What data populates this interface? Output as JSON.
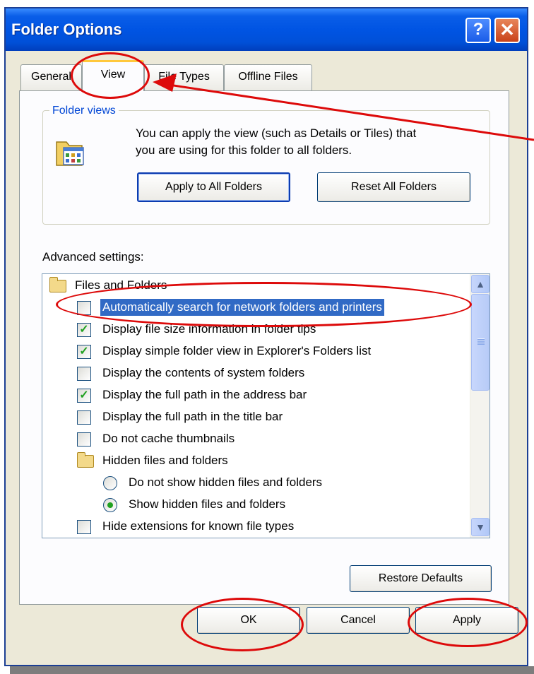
{
  "window": {
    "title": "Folder Options",
    "help_glyph": "?",
    "close_glyph": "✕"
  },
  "tabs": [
    {
      "label": "General",
      "active": false
    },
    {
      "label": "View",
      "active": true
    },
    {
      "label": "File Types",
      "active": false
    },
    {
      "label": "Offline Files",
      "active": false
    }
  ],
  "folder_views": {
    "group_label": "Folder views",
    "description_line1": "You can apply the view (such as Details or Tiles) that",
    "description_line2": "you are using for this folder to all folders.",
    "apply_button": "Apply to All Folders",
    "reset_button": "Reset All Folders"
  },
  "advanced": {
    "label": "Advanced settings:",
    "items": [
      {
        "kind": "folder",
        "label": "Files and Folders"
      },
      {
        "kind": "checkbox",
        "label": "Automatically search for network folders and printers",
        "checked": false,
        "selected": true
      },
      {
        "kind": "checkbox",
        "label": "Display file size information in folder tips",
        "checked": true
      },
      {
        "kind": "checkbox",
        "label": "Display simple folder view in Explorer's Folders list",
        "checked": true
      },
      {
        "kind": "checkbox",
        "label": "Display the contents of system folders",
        "checked": false
      },
      {
        "kind": "checkbox",
        "label": "Display the full path in the address bar",
        "checked": true
      },
      {
        "kind": "checkbox",
        "label": "Display the full path in the title bar",
        "checked": false
      },
      {
        "kind": "checkbox",
        "label": "Do not cache thumbnails",
        "checked": false
      },
      {
        "kind": "folder",
        "label": "Hidden files and folders"
      },
      {
        "kind": "radio",
        "label": "Do not show hidden files and folders",
        "checked": false
      },
      {
        "kind": "radio",
        "label": "Show hidden files and folders",
        "checked": true
      },
      {
        "kind": "checkbox",
        "label": "Hide extensions for known file types",
        "checked": false
      }
    ],
    "restore_button": "Restore Defaults"
  },
  "footer": {
    "ok": "OK",
    "cancel": "Cancel",
    "apply": "Apply"
  },
  "colors": {
    "annotation": "#dd0a0a",
    "selection": "#316ac5",
    "check": "#21a121"
  }
}
